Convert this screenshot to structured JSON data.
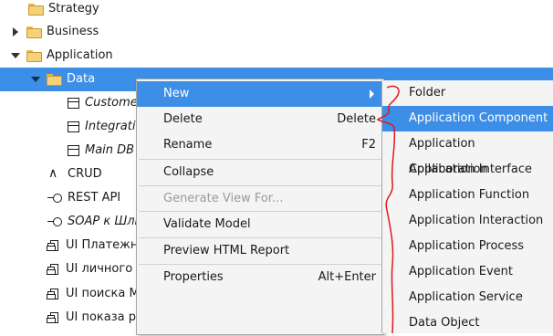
{
  "tree": {
    "items": [
      {
        "label": "Strategy",
        "icon": "folder-icon"
      },
      {
        "label": "Business",
        "icon": "folder-icon"
      },
      {
        "label": "Application",
        "icon": "folder-icon"
      },
      {
        "label": "Data",
        "icon": "folder-icon"
      },
      {
        "label": "Custome",
        "icon": "data-object-icon"
      },
      {
        "label": "Integratio",
        "icon": "data-object-icon"
      },
      {
        "label": "Main DB",
        "icon": "data-object-icon"
      },
      {
        "label": "CRUD",
        "icon": "application-function-icon"
      },
      {
        "label": "REST API",
        "icon": "application-interface-icon"
      },
      {
        "label": "SOAP к Шли",
        "icon": "application-interface-icon"
      },
      {
        "label": "UI Платежн",
        "icon": "application-component-icon"
      },
      {
        "label": "UI личного к",
        "icon": "application-component-icon"
      },
      {
        "label": "UI поиска МУ в реестре (компонент программы)",
        "icon": "application-component-icon"
      },
      {
        "label": "UI показа расписания МО и МР (компонент программы)",
        "icon": "application-component-icon"
      }
    ]
  },
  "context_menu": {
    "items": [
      {
        "label": "New",
        "shortcut": ""
      },
      {
        "label": "Delete",
        "shortcut": "Delete"
      },
      {
        "label": "Rename",
        "shortcut": "F2"
      },
      {
        "label": "Collapse",
        "shortcut": ""
      },
      {
        "label": "Generate View For...",
        "shortcut": ""
      },
      {
        "label": "Validate Model",
        "shortcut": ""
      },
      {
        "label": "Preview HTML Report",
        "shortcut": ""
      },
      {
        "label": "Properties",
        "shortcut": "Alt+Enter"
      }
    ]
  },
  "submenu": {
    "items": [
      {
        "label": "Folder"
      },
      {
        "label": "Application Component"
      },
      {
        "label": "Application Collaboration"
      },
      {
        "label": "Application Interface"
      },
      {
        "label": "Application Function"
      },
      {
        "label": "Application Interaction"
      },
      {
        "label": "Application Process"
      },
      {
        "label": "Application Event"
      },
      {
        "label": "Application Service"
      },
      {
        "label": "Data Object"
      }
    ]
  },
  "colors": {
    "selection": "#3d8ee6",
    "annotation": "#e0181e"
  }
}
